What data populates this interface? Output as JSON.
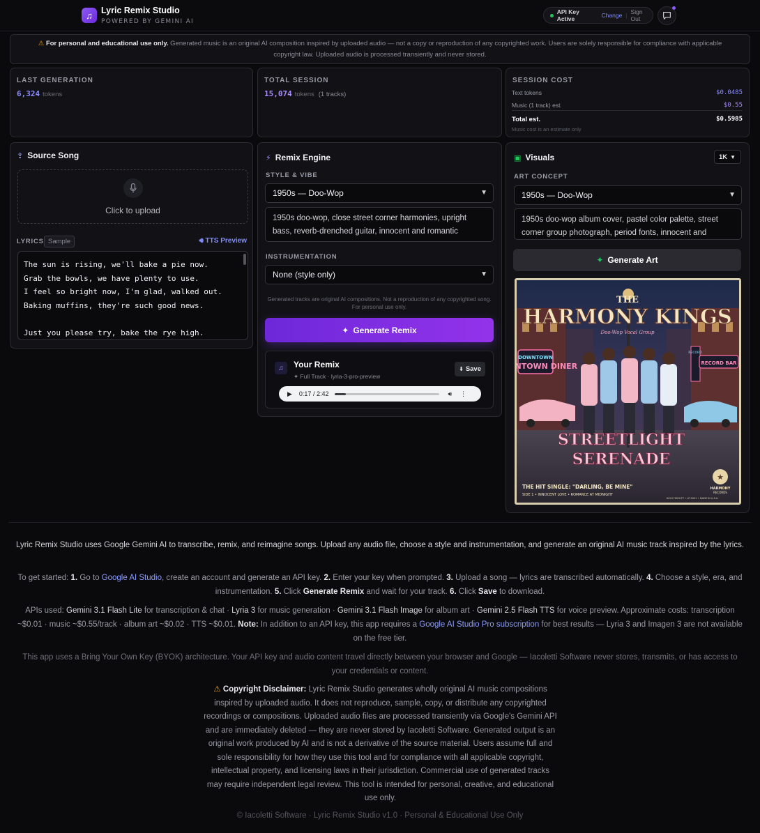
{
  "header": {
    "brand_title": "Lyric Remix Studio",
    "brand_sub": "POWERED BY GEMINI AI",
    "api_status": "API Key Active",
    "api_change": "Change",
    "api_signout": "Sign Out"
  },
  "banner": {
    "bold": "For personal and educational use only.",
    "text": " Generated music is an original AI composition inspired by uploaded audio — not a copy or reproduction of any copyrighted work. Users are solely responsible for compliance with applicable copyright law. Uploaded audio is processed transiently and never stored."
  },
  "stats": {
    "last_generation": {
      "label": "LAST GENERATION",
      "value": "6,324",
      "unit": "tokens"
    },
    "total_session": {
      "label": "TOTAL SESSION",
      "value": "15,074",
      "unit": "tokens",
      "extra": "(1 tracks)"
    },
    "session_cost": {
      "label": "SESSION COST",
      "text_tokens_label": "Text tokens",
      "text_tokens_value": "$0.0485",
      "music_label": "Music (1 track) est.",
      "music_value": "$0.55",
      "total_label": "Total est.",
      "total_value": "$0.5985",
      "note": "Music cost is an estimate only"
    }
  },
  "source": {
    "title": "Source Song",
    "upload_text": "Click to upload",
    "lyrics_label": "LYRICS",
    "sample_badge": "Sample",
    "tts_link": "TTS Preview",
    "lyrics_lines": [
      "The sun is rising, we'll bake a pie now.",
      "Grab the bowls, we have plenty to use.",
      "I feel so bright now, I'm glad, walked out.",
      "Baking muffins, they're such good news.",
      "",
      "Just you please try, bake the rye high."
    ]
  },
  "remix": {
    "title": "Remix Engine",
    "style_label": "STYLE & VIBE",
    "style_value": "1950s — Doo-Wop",
    "style_desc": "1950s doo-wop, close street corner harmonies, upright bass, reverb-drenched guitar, innocent and romantic",
    "instr_label": "INSTRUMENTATION",
    "instr_value": "None (style only)",
    "note": "Generated tracks are original AI compositions. Not a reproduction of any copyrighted song. For personal use only.",
    "generate_button": "Generate Remix",
    "your_remix_title": "Your Remix",
    "your_remix_sub": "✦ Full Track · lyria-3-pro-preview",
    "save_button": "Save",
    "player_time": "0:17 / 2:42",
    "progress": 0.105
  },
  "visuals": {
    "title": "Visuals",
    "size": "1K",
    "art_label": "ART CONCEPT",
    "art_value": "1950s — Doo-Wop",
    "art_desc": "1950s doo-wop album cover, pastel color palette, street corner group photograph, period fonts, innocent and romantic",
    "generate_button": "Generate Art",
    "album": {
      "top_the": "THE",
      "band_name": "HARMONY KINGS",
      "band_sub": "Doo-Wop Vocal Group",
      "sign_left": "DOWNTOWN DINER",
      "sign_right": "RECORD BAR",
      "sign_record": "RECORD",
      "album_title_1": "STREETLIGHT",
      "album_title_2": "SERENADE",
      "single": "THE HIT SINGLE: \"DARLING, BE MINE\"",
      "side": "SIDE 1 • INNOCENT LOVE • ROMANCE AT MIDNIGHT",
      "label_name": "HARMONY",
      "label_sub": "RECORDS",
      "fine": "HIGH FIDELITY • LP-5001 • MADE IN U.S.A."
    }
  },
  "footer": {
    "intro": "Lyric Remix Studio uses Google Gemini AI to transcribe, remix, and reimagine songs. Upload any audio file, choose a style and instrumentation, and generate an original AI music track inspired by the lyrics.",
    "steps_a": "To get started: ",
    "s1": "1.",
    "s1_text_a": " Go to ",
    "s1_link": "Google AI Studio",
    "s1_text_b": ", create an account and generate an API key. ",
    "s2": "2.",
    "s2_text": " Enter your key when prompted. ",
    "s3": "3.",
    "s3_text": " Upload a song — lyrics are transcribed automatically. ",
    "s4": "4.",
    "s4_text": " Choose a style, era, and instrumentation. ",
    "s5": "5.",
    "s5_text_a": " Click ",
    "s5_bold": "Generate Remix",
    "s5_text_b": " and wait for your track. ",
    "s6": "6.",
    "s6_text_a": " Click ",
    "s6_bold": "Save",
    "s6_text_b": " to download.",
    "apis_a": "APIs used: ",
    "api1": "Gemini 3.1 Flash Lite",
    "api1_t": " for transcription & chat · ",
    "api2": "Lyria 3",
    "api2_t": " for music generation · ",
    "api3": "Gemini 3.1 Flash Image",
    "api3_t": " for album art · ",
    "api4": "Gemini 2.5 Flash TTS",
    "api4_t": " for voice preview. Approximate costs: transcription ~$0.01 · music ~$0.55/track · album art ~$0.02 · TTS ~$0.01. ",
    "note_bold": "Note:",
    "note_a": " In addition to an API key, this app requires a ",
    "note_link": "Google AI Studio Pro subscription",
    "note_b": " for best results — Lyria 3 and Imagen 3 are not available on the free tier.",
    "byok": "This app uses a Bring Your Own Key (BYOK) architecture. Your API key and audio content travel directly between your browser and Google — Iacoletti Software never stores, transmits, or has access to your credentials or content.",
    "disc_bold": "Copyright Disclaimer:",
    "disc_text": " Lyric Remix Studio generates wholly original AI music compositions inspired by uploaded audio. It does not reproduce, sample, copy, or distribute any copyrighted recordings or compositions. Uploaded audio files are processed transiently via Google's Gemini API and are immediately deleted — they are never stored by Iacoletti Software. Generated output is an original work produced by AI and is not a derivative of the source material. Users assume full and sole responsibility for how they use this tool and for compliance with all applicable copyright, intellectual property, and licensing laws in their jurisdiction. Commercial use of generated tracks may require independent legal review. This tool is intended for personal, creative, and educational use only.",
    "copyright": "© Iacoletti Software · Lyric Remix Studio v1.0 · Personal & Educational Use Only"
  },
  "colors": {
    "accent": "#7c3aed",
    "link": "#818cf8",
    "status": "#22c55e",
    "warning": "#f59e0b"
  }
}
